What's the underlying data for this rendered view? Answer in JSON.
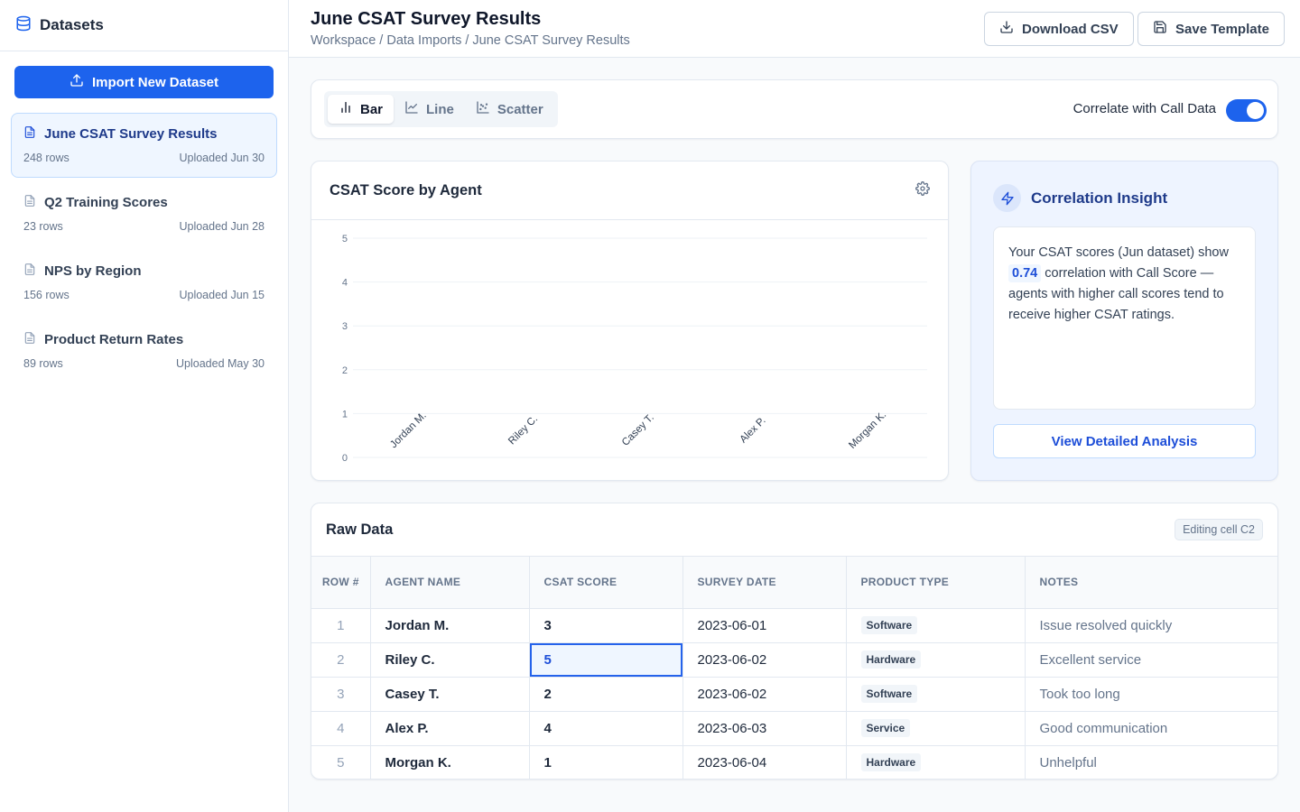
{
  "sidebar": {
    "title": "Datasets",
    "import_label": "Import New Dataset",
    "datasets": [
      {
        "name": "June CSAT Survey Results",
        "rows": "248 rows",
        "uploaded": "Uploaded Jun 30",
        "active": true
      },
      {
        "name": "Q2 Training Scores",
        "rows": "23 rows",
        "uploaded": "Uploaded Jun 28"
      },
      {
        "name": "NPS by Region",
        "rows": "156 rows",
        "uploaded": "Uploaded Jun 15"
      },
      {
        "name": "Product Return Rates",
        "rows": "89 rows",
        "uploaded": "Uploaded May 30"
      }
    ]
  },
  "header": {
    "title": "June CSAT Survey Results",
    "breadcrumb": "Workspace / Data Imports / June CSAT Survey Results",
    "download_label": "Download CSV",
    "save_label": "Save Template"
  },
  "toolbar": {
    "chart_types": [
      "Bar",
      "Line",
      "Scatter"
    ],
    "selected_chart_type": "Bar",
    "correlate_label": "Correlate with Call Data",
    "correlate_enabled": true
  },
  "chart_data": {
    "type": "bar",
    "title": "CSAT Score by Agent",
    "categories": [
      "Jordan M.",
      "Riley C.",
      "Casey T.",
      "Alex P.",
      "Morgan K."
    ],
    "values": [],
    "y_ticks": [
      "0",
      "1",
      "2",
      "3",
      "4",
      "5"
    ],
    "ylim": [
      0,
      5
    ],
    "grid": true,
    "xlabel": "",
    "ylabel": ""
  },
  "insight": {
    "title": "Correlation Insight",
    "text_before": "Your CSAT scores (Jun dataset) show",
    "value": "0.74",
    "text_after": "correlation with Call Score — agents with higher call scores tend to receive higher CSAT ratings.",
    "button_label": "View Detailed Analysis"
  },
  "table": {
    "title": "Raw Data",
    "editing_label": "Editing cell C2",
    "columns": [
      "ROW #",
      "AGENT NAME",
      "CSAT SCORE",
      "SURVEY DATE",
      "PRODUCT TYPE",
      "NOTES"
    ],
    "rows": [
      {
        "num": "1",
        "agent": "Jordan M.",
        "score": "3",
        "date": "2023-06-01",
        "product": "Software",
        "notes": "Issue resolved quickly"
      },
      {
        "num": "2",
        "agent": "Riley C.",
        "score": "5",
        "date": "2023-06-02",
        "product": "Hardware",
        "notes": "Excellent service"
      },
      {
        "num": "3",
        "agent": "Casey T.",
        "score": "2",
        "date": "2023-06-02",
        "product": "Software",
        "notes": "Took too long"
      },
      {
        "num": "4",
        "agent": "Alex P.",
        "score": "4",
        "date": "2023-06-03",
        "product": "Service",
        "notes": "Good communication"
      },
      {
        "num": "5",
        "agent": "Morgan K.",
        "score": "1",
        "date": "2023-06-04",
        "product": "Hardware",
        "notes": "Unhelpful"
      }
    ]
  },
  "colors": {
    "primary": "#1d63ed",
    "accent_dark": "#1e3a8a",
    "border": "#e2e8f0"
  }
}
